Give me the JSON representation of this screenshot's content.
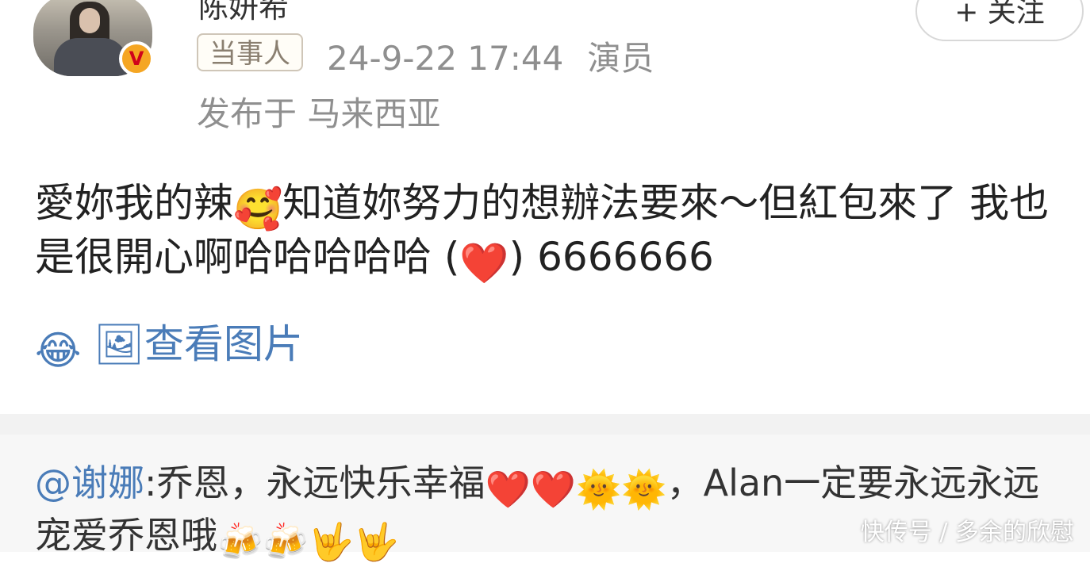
{
  "post": {
    "username": "陈妍希",
    "follow_label": "+ 关注",
    "tag": "当事人",
    "timestamp": "24-9-22 17:44",
    "source": "演员",
    "location": "发布于 马来西亚",
    "text_part1": "愛妳我的辣",
    "emoji_smile_hearts": "🥰",
    "text_part2": "知道妳努力的想辦法要來～但紅包來了 我也是很開心啊哈哈哈哈哈 (",
    "emoji_heart": "❤️",
    "text_part3": ") 6666666",
    "emoji_tears": "😂",
    "view_pictures_icon": "🖼",
    "view_pictures_label": "查看图片"
  },
  "comment": {
    "mention": "@谢娜",
    "text_part1": ":乔恩，永远快乐幸福",
    "emojis_1": "❤️❤️🌞🌞",
    "text_part2": "，Alan一定要永远永远宠爱乔恩哦",
    "emojis_2": "🍻🍻🤟🤟"
  },
  "watermark": "快传号 / 多余的欣慰",
  "colors": {
    "link_blue": "#4a7cb8",
    "meta_gray": "#8f8f8f",
    "verified_orange": "#f5a623",
    "comment_bg": "#f7f7f7"
  }
}
